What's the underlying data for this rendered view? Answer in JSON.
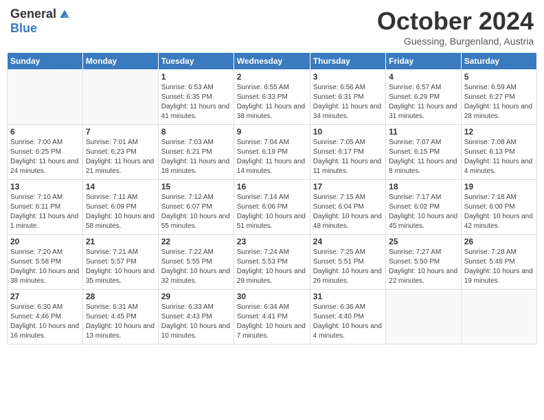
{
  "header": {
    "logo_general": "General",
    "logo_blue": "Blue",
    "month": "October 2024",
    "location": "Guessing, Burgenland, Austria"
  },
  "days_of_week": [
    "Sunday",
    "Monday",
    "Tuesday",
    "Wednesday",
    "Thursday",
    "Friday",
    "Saturday"
  ],
  "weeks": [
    [
      {
        "day": "",
        "info": ""
      },
      {
        "day": "",
        "info": ""
      },
      {
        "day": "1",
        "info": "Sunrise: 6:53 AM\nSunset: 6:35 PM\nDaylight: 11 hours and 41 minutes."
      },
      {
        "day": "2",
        "info": "Sunrise: 6:55 AM\nSunset: 6:33 PM\nDaylight: 11 hours and 38 minutes."
      },
      {
        "day": "3",
        "info": "Sunrise: 6:56 AM\nSunset: 6:31 PM\nDaylight: 11 hours and 34 minutes."
      },
      {
        "day": "4",
        "info": "Sunrise: 6:57 AM\nSunset: 6:29 PM\nDaylight: 11 hours and 31 minutes."
      },
      {
        "day": "5",
        "info": "Sunrise: 6:59 AM\nSunset: 6:27 PM\nDaylight: 11 hours and 28 minutes."
      }
    ],
    [
      {
        "day": "6",
        "info": "Sunrise: 7:00 AM\nSunset: 6:25 PM\nDaylight: 11 hours and 24 minutes."
      },
      {
        "day": "7",
        "info": "Sunrise: 7:01 AM\nSunset: 6:23 PM\nDaylight: 11 hours and 21 minutes."
      },
      {
        "day": "8",
        "info": "Sunrise: 7:03 AM\nSunset: 6:21 PM\nDaylight: 11 hours and 18 minutes."
      },
      {
        "day": "9",
        "info": "Sunrise: 7:04 AM\nSunset: 6:19 PM\nDaylight: 11 hours and 14 minutes."
      },
      {
        "day": "10",
        "info": "Sunrise: 7:05 AM\nSunset: 6:17 PM\nDaylight: 11 hours and 11 minutes."
      },
      {
        "day": "11",
        "info": "Sunrise: 7:07 AM\nSunset: 6:15 PM\nDaylight: 11 hours and 8 minutes."
      },
      {
        "day": "12",
        "info": "Sunrise: 7:08 AM\nSunset: 6:13 PM\nDaylight: 11 hours and 4 minutes."
      }
    ],
    [
      {
        "day": "13",
        "info": "Sunrise: 7:10 AM\nSunset: 6:11 PM\nDaylight: 11 hours and 1 minute."
      },
      {
        "day": "14",
        "info": "Sunrise: 7:11 AM\nSunset: 6:09 PM\nDaylight: 10 hours and 58 minutes."
      },
      {
        "day": "15",
        "info": "Sunrise: 7:12 AM\nSunset: 6:07 PM\nDaylight: 10 hours and 55 minutes."
      },
      {
        "day": "16",
        "info": "Sunrise: 7:14 AM\nSunset: 6:06 PM\nDaylight: 10 hours and 51 minutes."
      },
      {
        "day": "17",
        "info": "Sunrise: 7:15 AM\nSunset: 6:04 PM\nDaylight: 10 hours and 48 minutes."
      },
      {
        "day": "18",
        "info": "Sunrise: 7:17 AM\nSunset: 6:02 PM\nDaylight: 10 hours and 45 minutes."
      },
      {
        "day": "19",
        "info": "Sunrise: 7:18 AM\nSunset: 6:00 PM\nDaylight: 10 hours and 42 minutes."
      }
    ],
    [
      {
        "day": "20",
        "info": "Sunrise: 7:20 AM\nSunset: 5:58 PM\nDaylight: 10 hours and 38 minutes."
      },
      {
        "day": "21",
        "info": "Sunrise: 7:21 AM\nSunset: 5:57 PM\nDaylight: 10 hours and 35 minutes."
      },
      {
        "day": "22",
        "info": "Sunrise: 7:22 AM\nSunset: 5:55 PM\nDaylight: 10 hours and 32 minutes."
      },
      {
        "day": "23",
        "info": "Sunrise: 7:24 AM\nSunset: 5:53 PM\nDaylight: 10 hours and 29 minutes."
      },
      {
        "day": "24",
        "info": "Sunrise: 7:25 AM\nSunset: 5:51 PM\nDaylight: 10 hours and 26 minutes."
      },
      {
        "day": "25",
        "info": "Sunrise: 7:27 AM\nSunset: 5:50 PM\nDaylight: 10 hours and 22 minutes."
      },
      {
        "day": "26",
        "info": "Sunrise: 7:28 AM\nSunset: 5:48 PM\nDaylight: 10 hours and 19 minutes."
      }
    ],
    [
      {
        "day": "27",
        "info": "Sunrise: 6:30 AM\nSunset: 4:46 PM\nDaylight: 10 hours and 16 minutes."
      },
      {
        "day": "28",
        "info": "Sunrise: 6:31 AM\nSunset: 4:45 PM\nDaylight: 10 hours and 13 minutes."
      },
      {
        "day": "29",
        "info": "Sunrise: 6:33 AM\nSunset: 4:43 PM\nDaylight: 10 hours and 10 minutes."
      },
      {
        "day": "30",
        "info": "Sunrise: 6:34 AM\nSunset: 4:41 PM\nDaylight: 10 hours and 7 minutes."
      },
      {
        "day": "31",
        "info": "Sunrise: 6:36 AM\nSunset: 4:40 PM\nDaylight: 10 hours and 4 minutes."
      },
      {
        "day": "",
        "info": ""
      },
      {
        "day": "",
        "info": ""
      }
    ]
  ]
}
